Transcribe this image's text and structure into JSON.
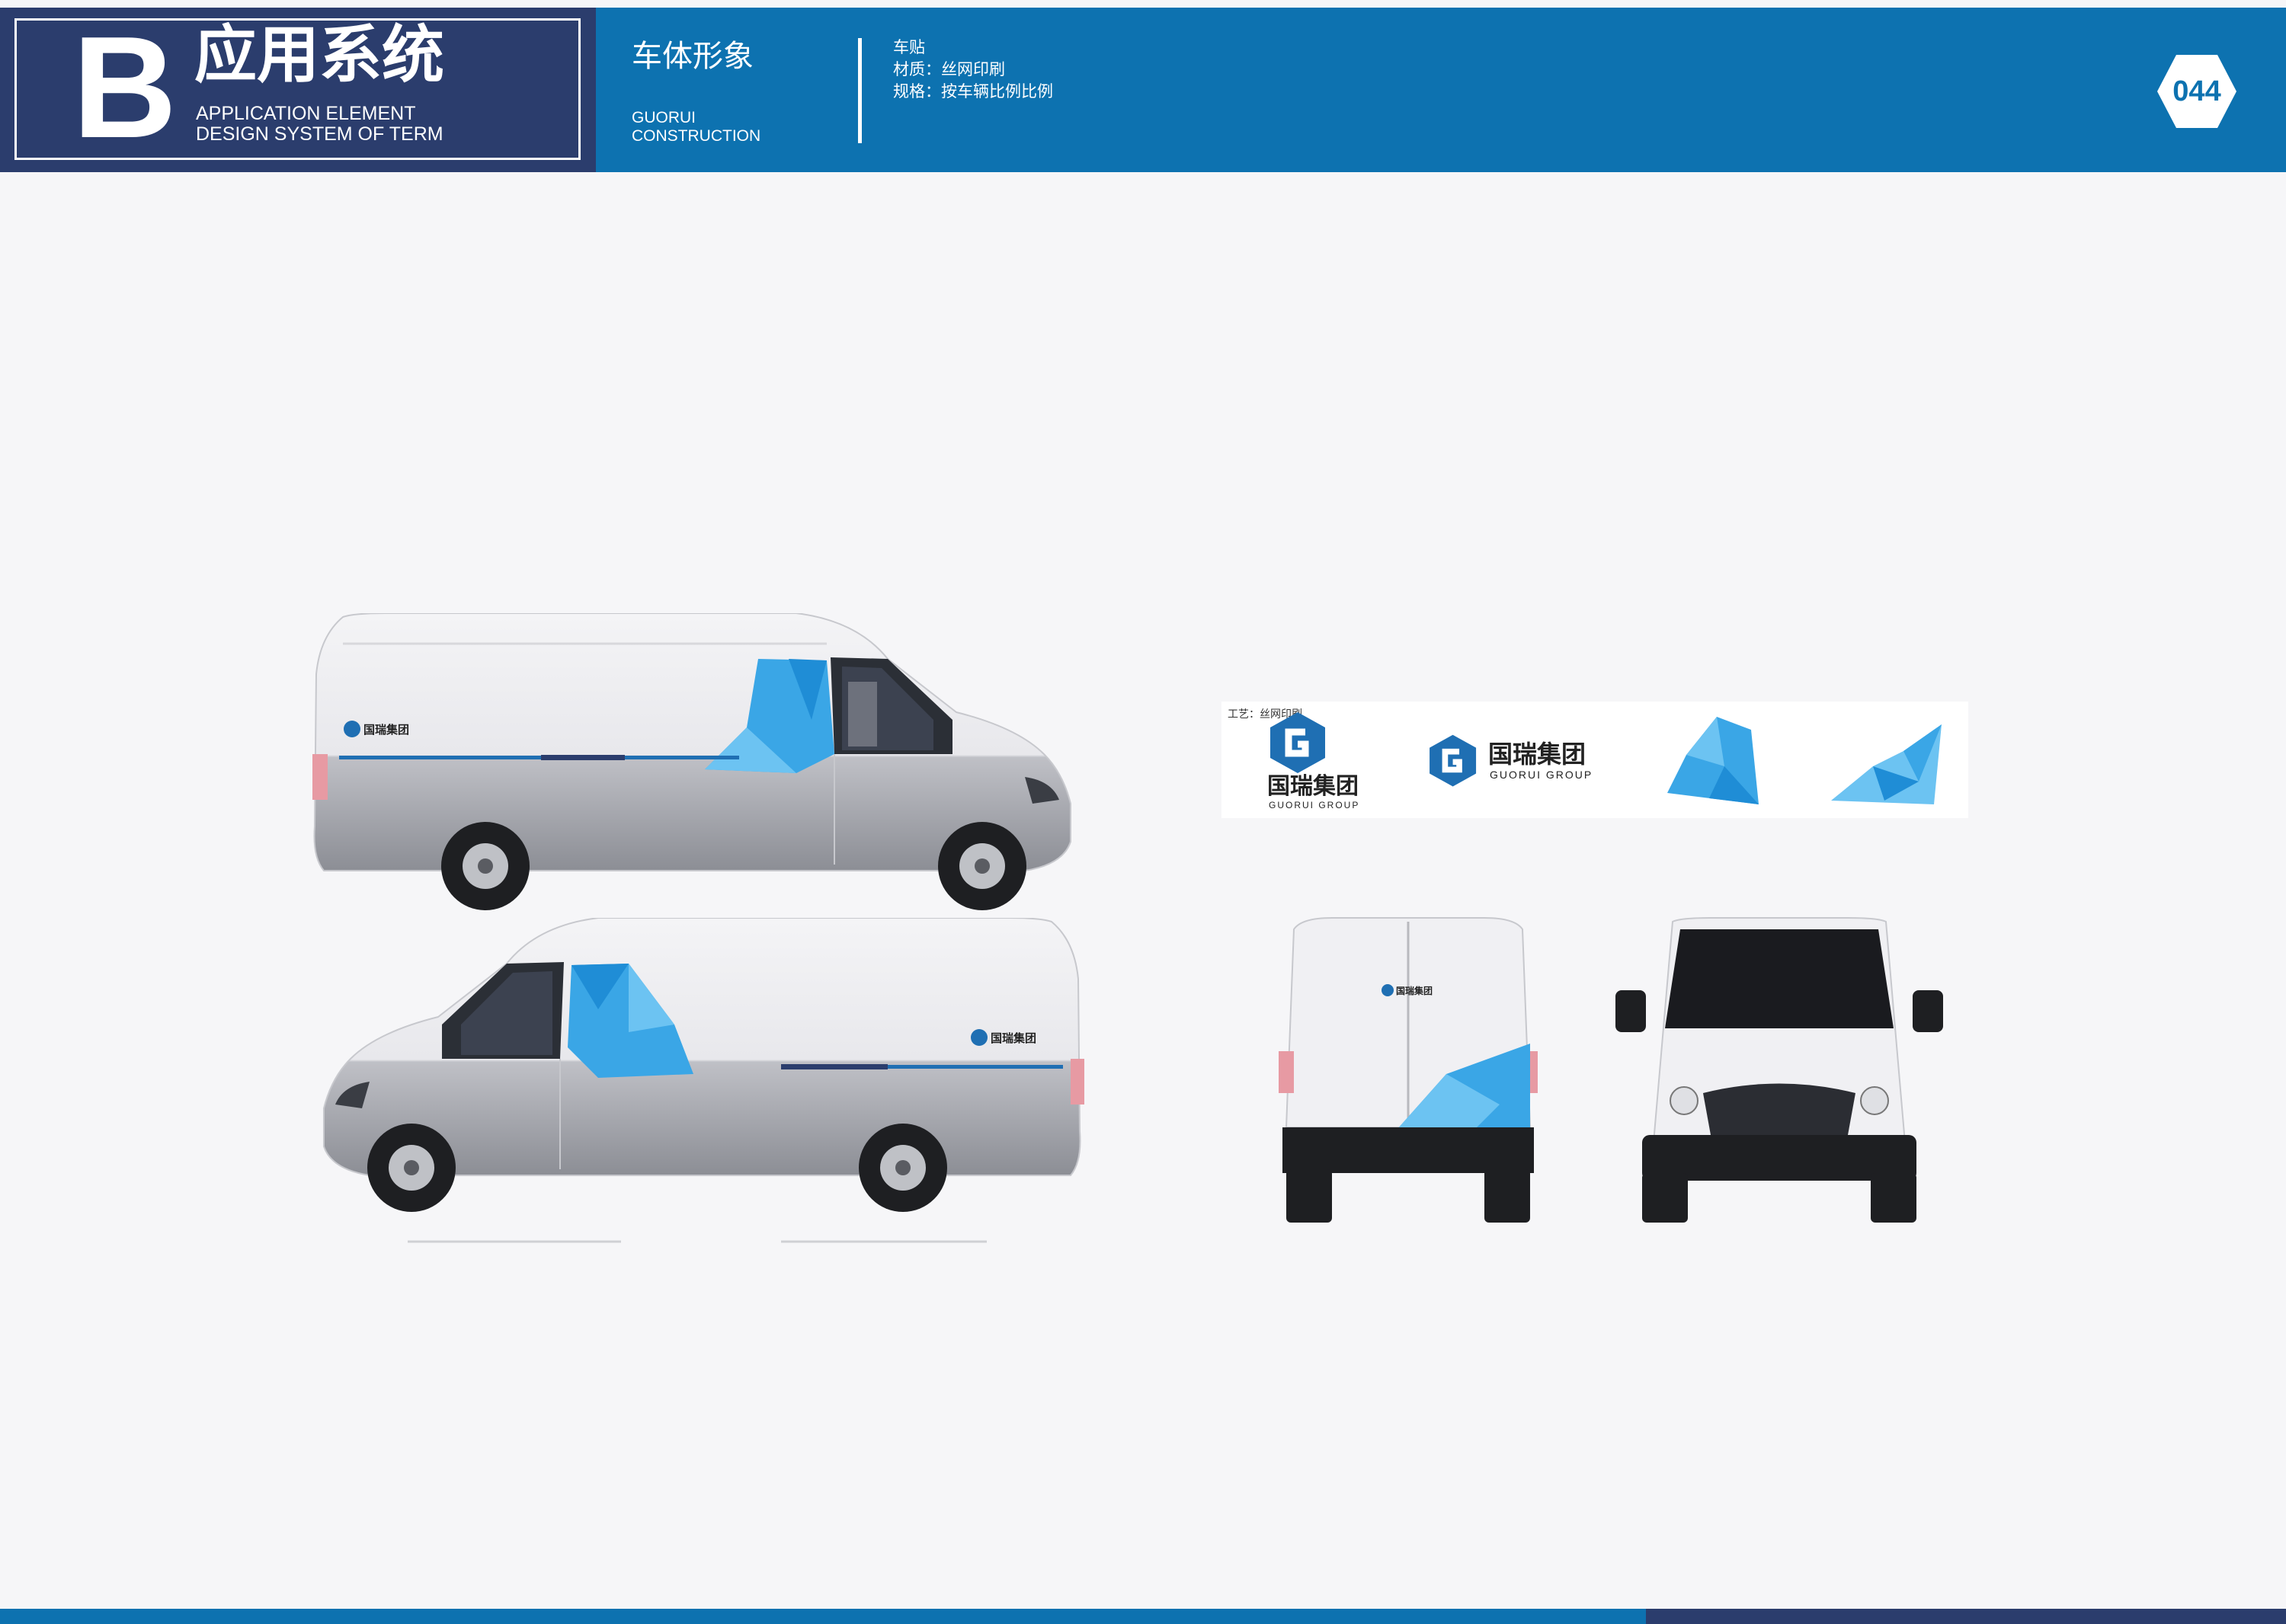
{
  "header": {
    "letter": "B",
    "section_title": "应用系统",
    "section_sub_1": "APPLICATION ELEMENT",
    "section_sub_2": "DESIGN SYSTEM OF TERM",
    "page_title": "车体形象",
    "company_1": "GUORUI",
    "company_2": "CONSTRUCTION",
    "spec_1": "车贴",
    "spec_2": "材质：丝网印刷",
    "spec_3": "规格：按车辆比例比例",
    "page_number": "044"
  },
  "logo": {
    "cn": "国瑞集团",
    "en": "GUORUI GROUP"
  },
  "strip": {
    "label": "工艺：丝网印刷"
  },
  "colors": {
    "header_blue": "#0d72b0",
    "navy": "#2b3d6d",
    "facet_blue": "#3aa6e6"
  }
}
